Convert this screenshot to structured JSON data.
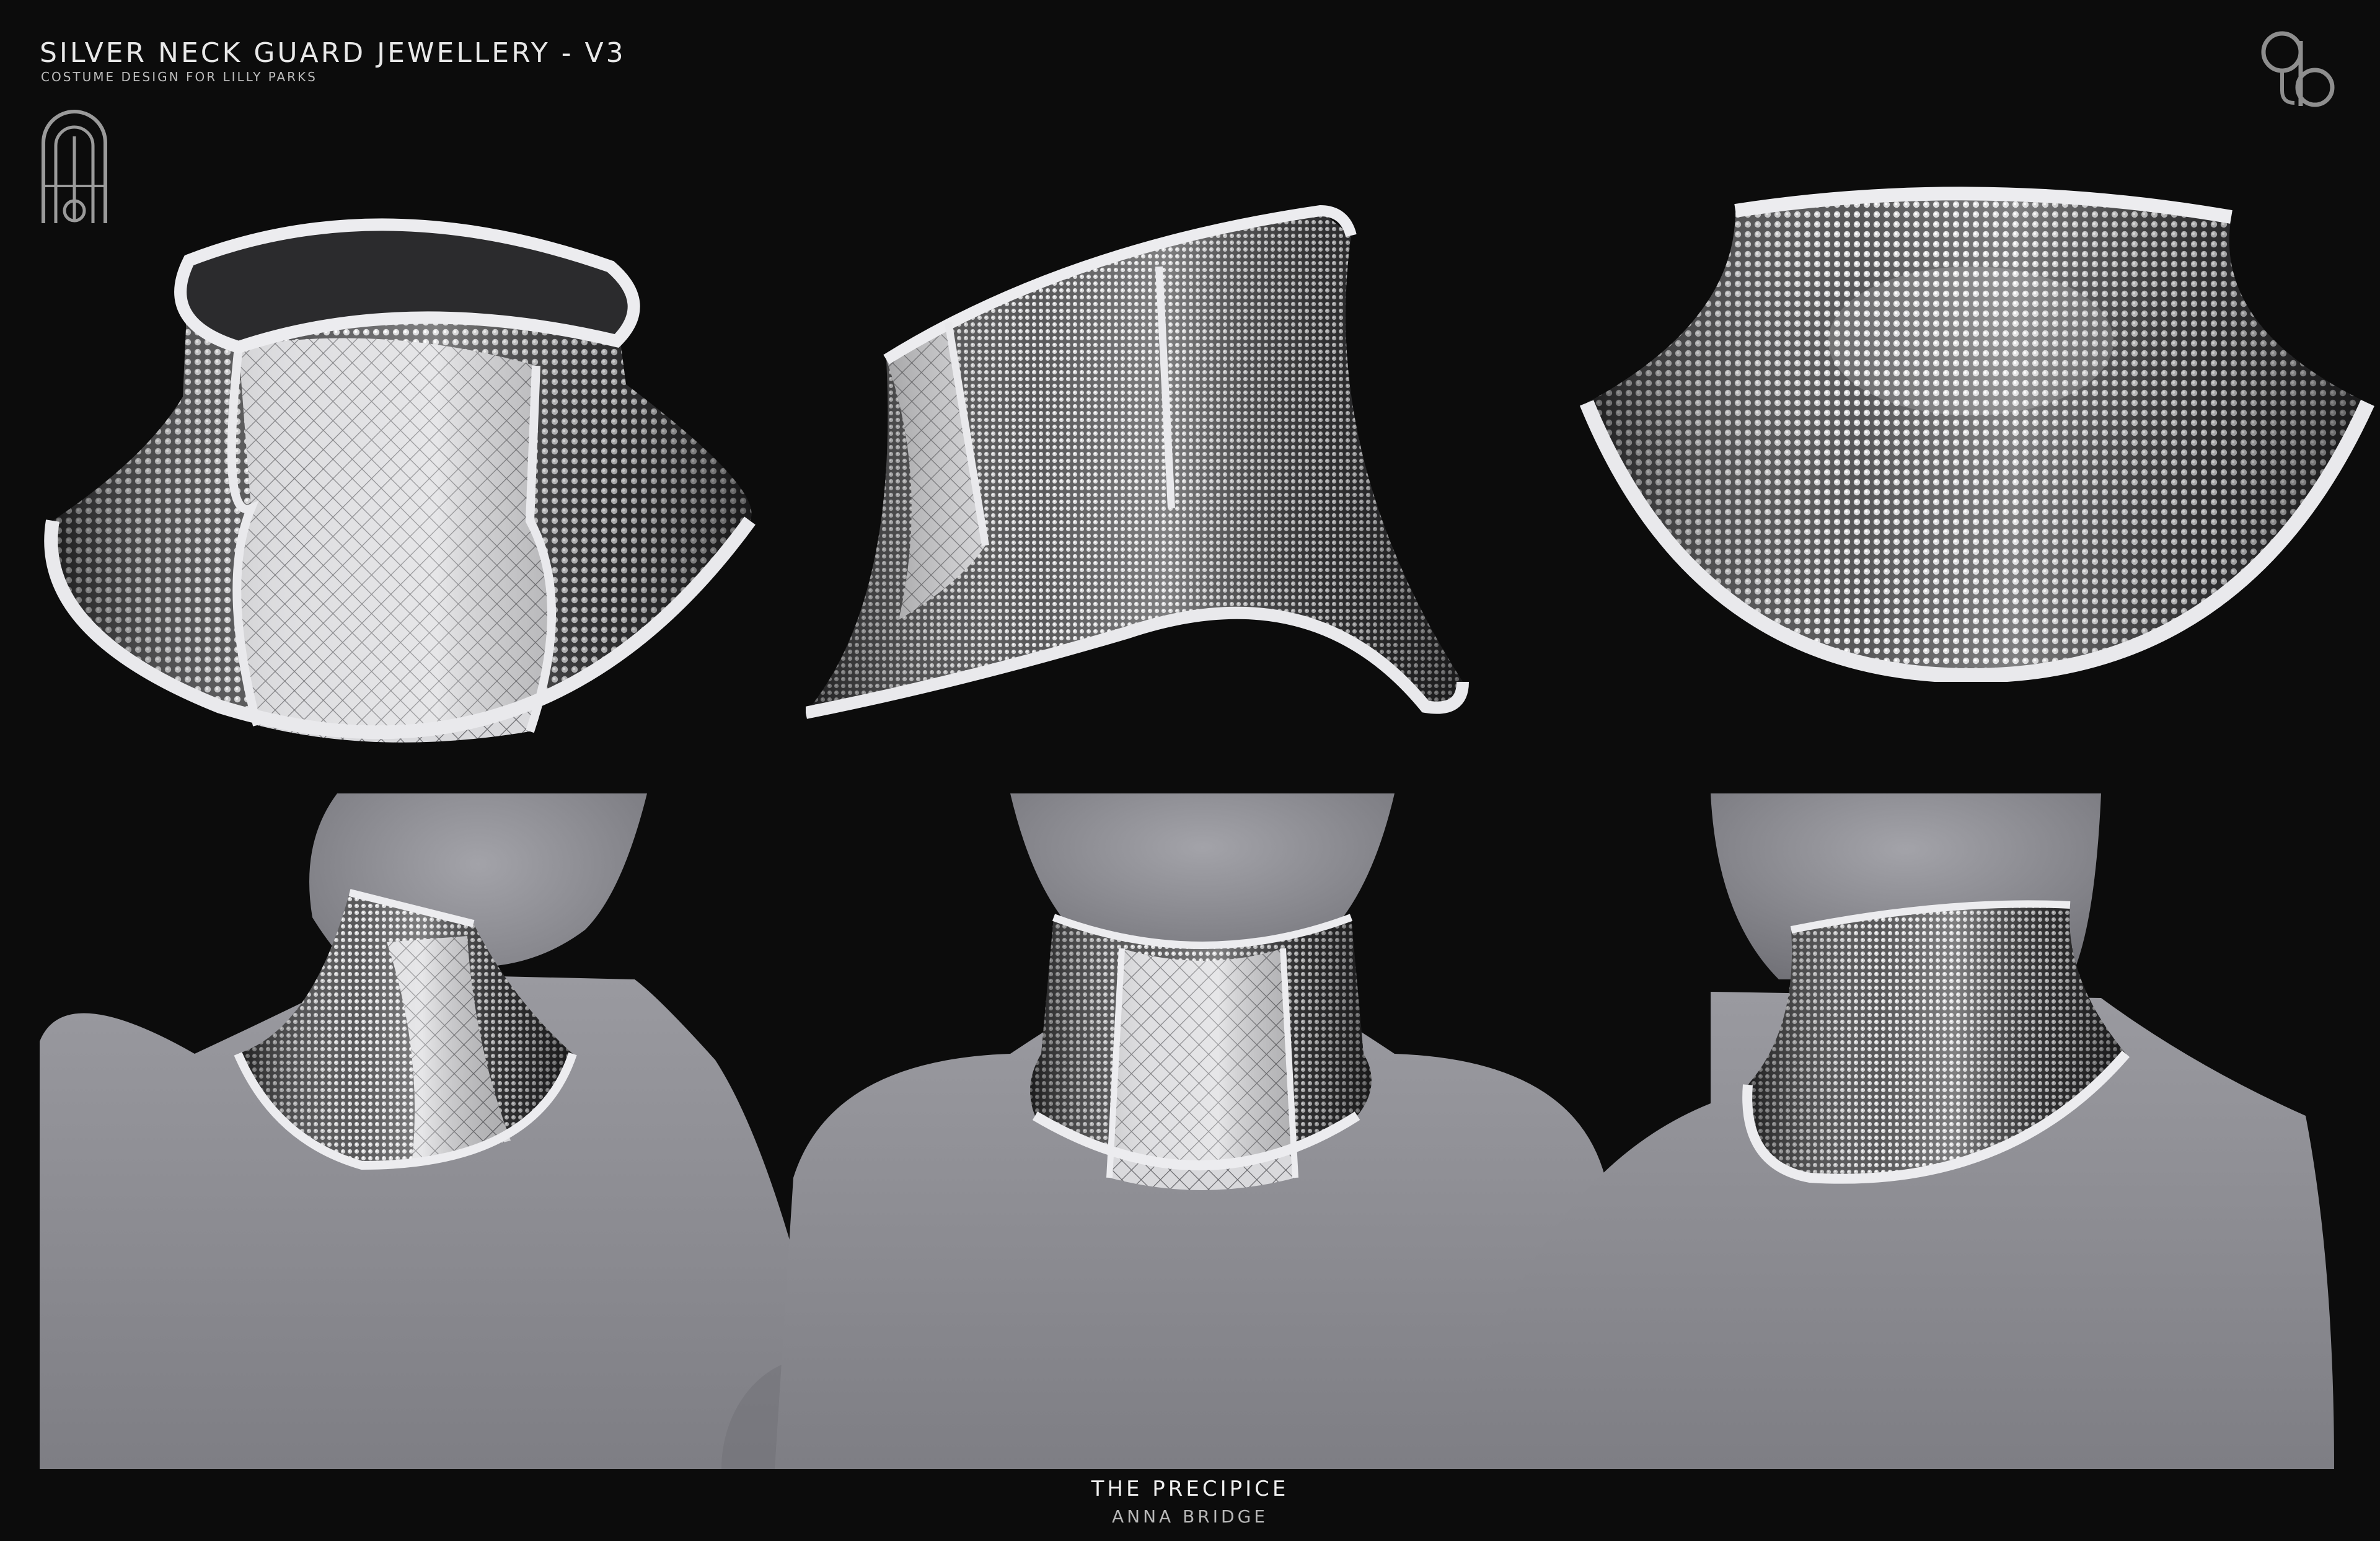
{
  "header": {
    "title": "SILVER NECK GUARD JEWELLERY - V3",
    "subtitle": "COSTUME DESIGN FOR LILLY PARKS"
  },
  "footer": {
    "title": "THE PRECIPICE",
    "author": "ANNA BRIDGE"
  },
  "colors": {
    "background": "#0c0c0c",
    "silver": "#c9c9c9",
    "mannequin": "#8a8a90",
    "text": "#e8e8e8"
  },
  "views": [
    "neck-guard-front-three-quarter",
    "neck-guard-side",
    "neck-guard-back",
    "mannequin-three-quarter",
    "mannequin-front",
    "mannequin-back"
  ]
}
